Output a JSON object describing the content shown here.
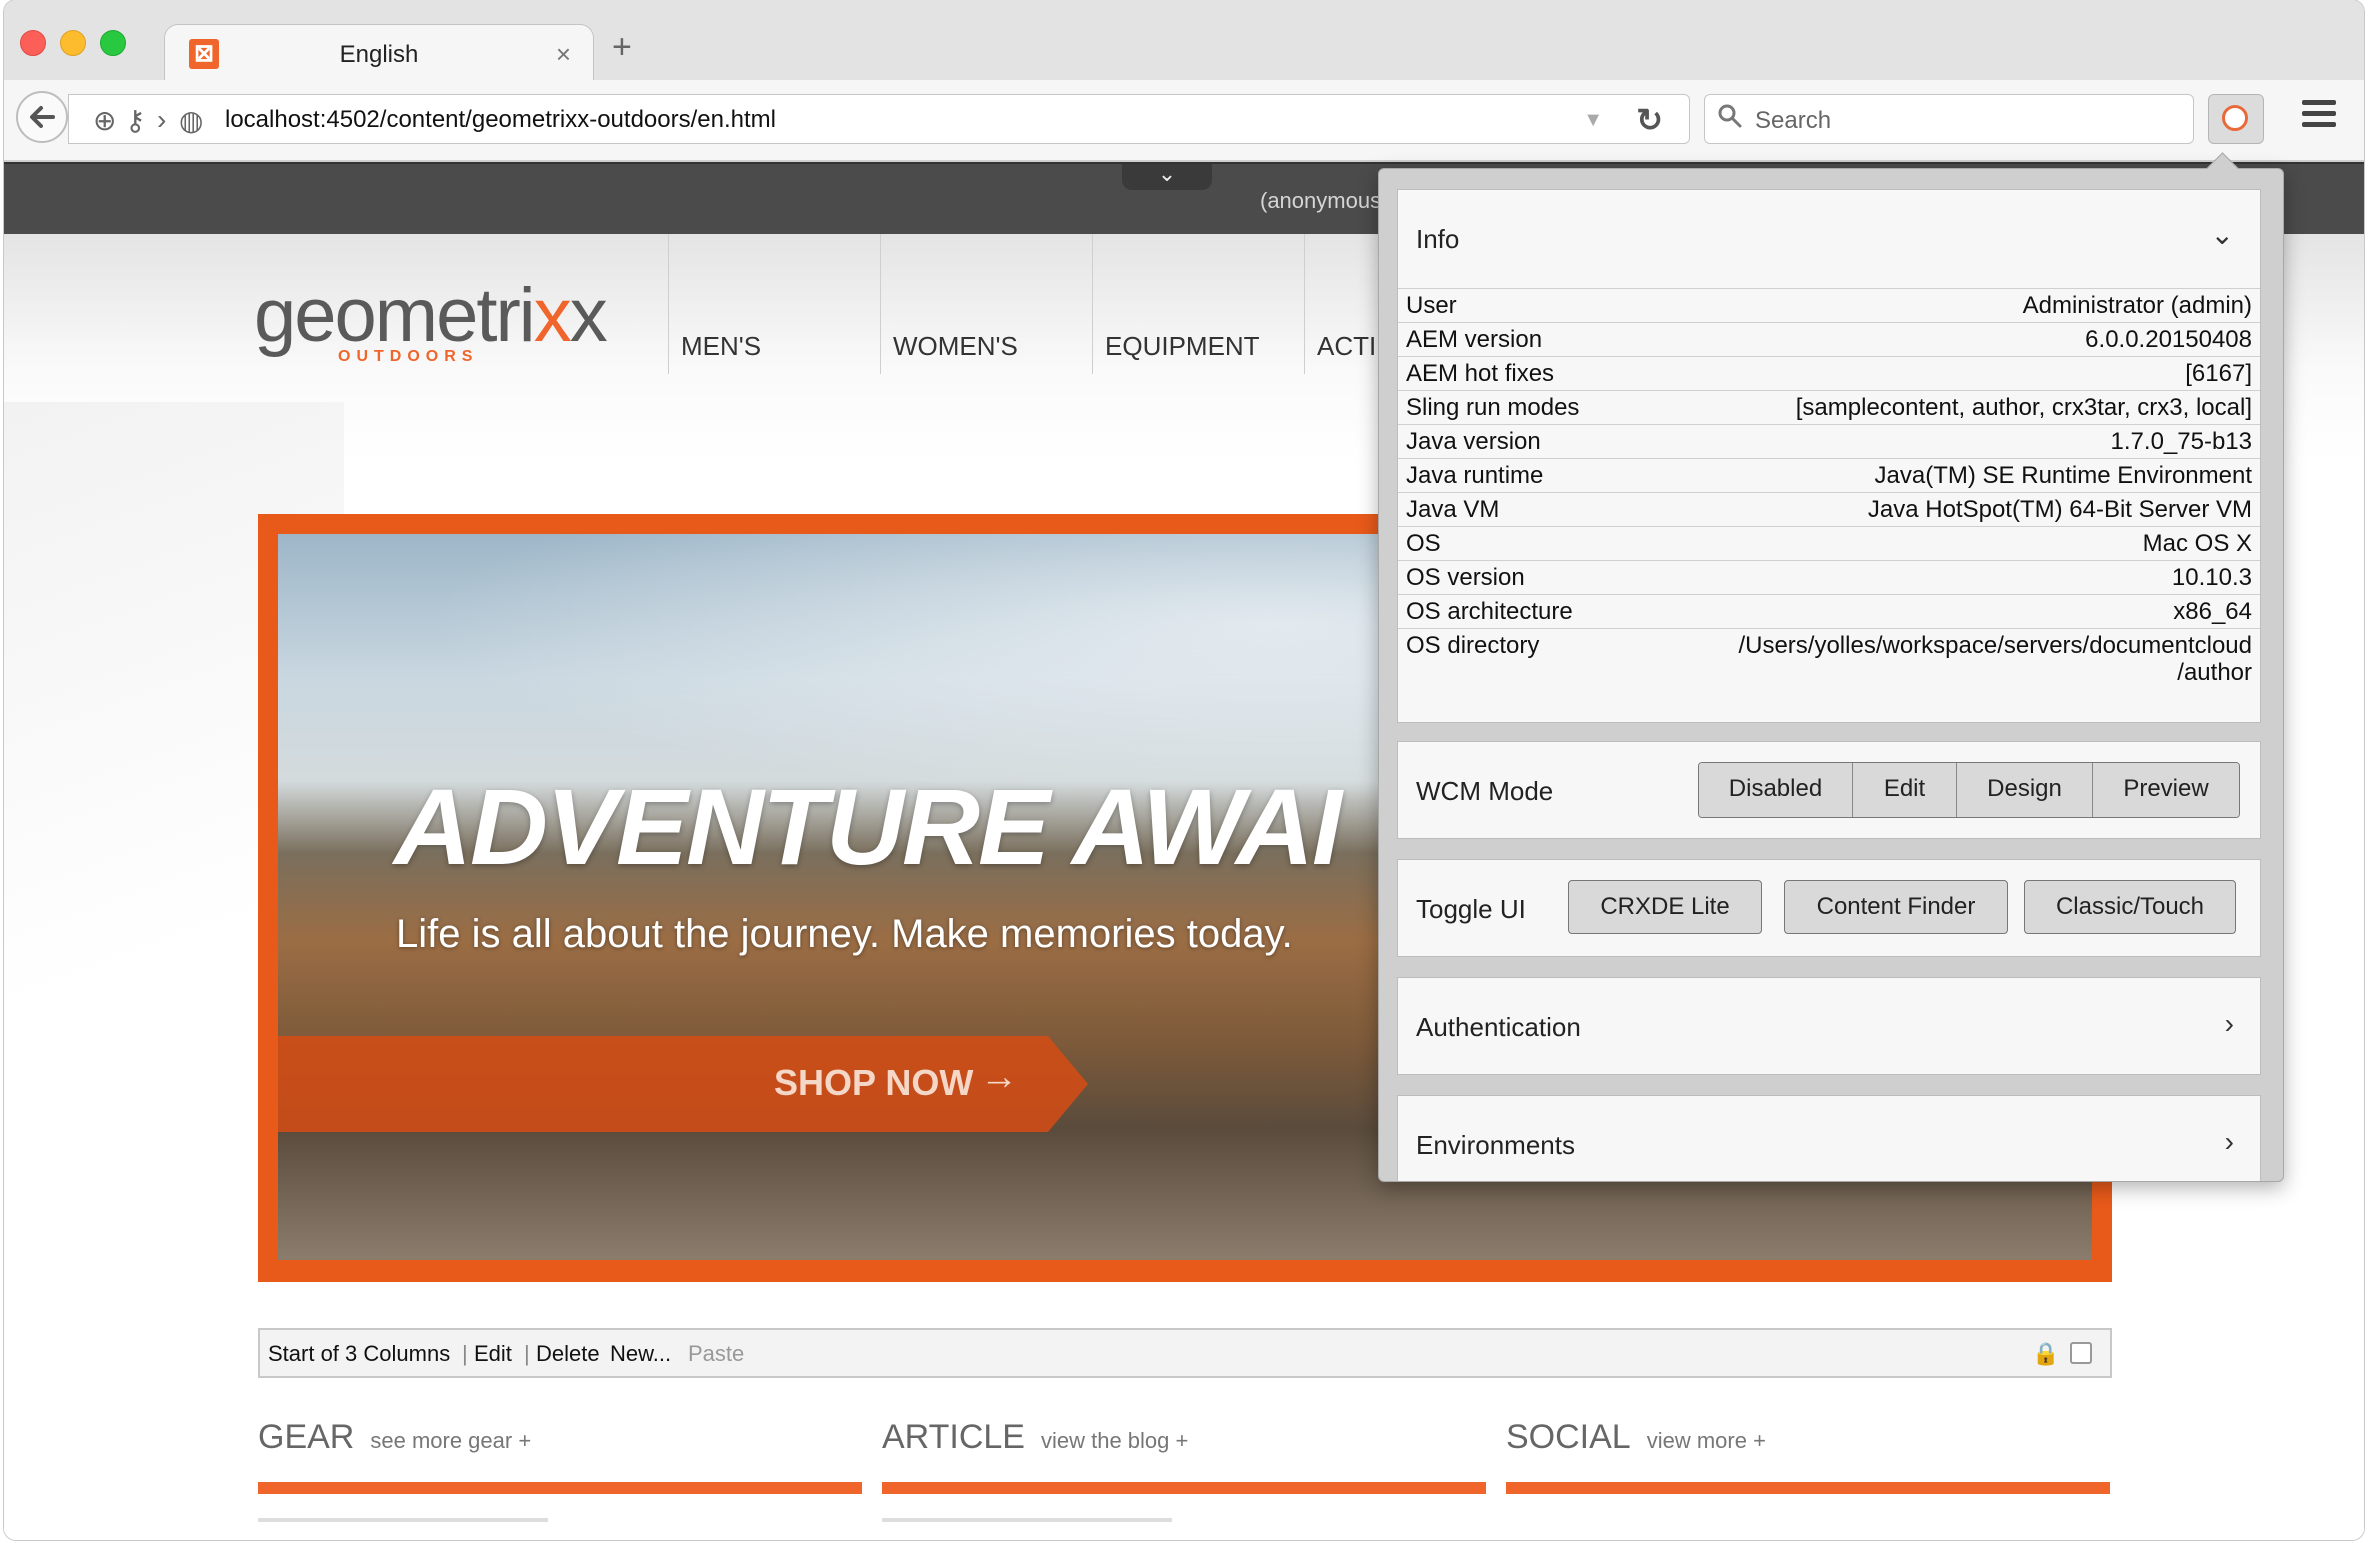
{
  "browser": {
    "tab_title": "English",
    "tab_close": "×",
    "new_tab": "+",
    "url": "localhost:4502/content/geometrixx-outdoors/en.html",
    "search_placeholder": "Search"
  },
  "aem_bar": {
    "toggle": "⌄",
    "user_label": "(anonymous"
  },
  "site": {
    "logo_text_a": "geometri",
    "logo_text_x": "x",
    "logo_text_b": "x",
    "logo_sub": "OUTDOORS",
    "nav": [
      "MEN'S",
      "WOMEN'S",
      "EQUIPMENT",
      "ACTI"
    ],
    "hero": {
      "title": "ADVENTURE AWAI",
      "subtitle": "Life is all about the journey. Make memories today.",
      "button": "SHOP NOW",
      "button_arrow": "→"
    },
    "editbar": {
      "label": "Start of 3 Columns",
      "edit": "Edit",
      "delete": "Delete",
      "new": "New...",
      "paste": "Paste"
    },
    "sections": [
      {
        "title": "GEAR",
        "link": "see more gear +"
      },
      {
        "title": "ARTICLE",
        "link": "view the blog +"
      },
      {
        "title": "SOCIAL",
        "link": "view more +"
      }
    ]
  },
  "panel": {
    "info": {
      "title": "Info",
      "chevron": "⌄",
      "rows": [
        {
          "label": "User",
          "value": "Administrator (admin)"
        },
        {
          "label": "AEM version",
          "value": "6.0.0.20150408"
        },
        {
          "label": "AEM hot fixes",
          "value": "[6167]"
        },
        {
          "label": "Sling run modes",
          "value": "[samplecontent, author, crx3tar, crx3, local]"
        },
        {
          "label": "Java version",
          "value": "1.7.0_75-b13"
        },
        {
          "label": "Java runtime",
          "value": "Java(TM) SE Runtime Environment"
        },
        {
          "label": "Java VM",
          "value": "Java HotSpot(TM) 64-Bit Server VM"
        },
        {
          "label": "OS",
          "value": "Mac OS X"
        },
        {
          "label": "OS version",
          "value": "10.10.3"
        },
        {
          "label": "OS architecture",
          "value": "x86_64"
        },
        {
          "label": "OS directory",
          "value": "/Users/yolles/workspace/servers/documentcloud\n/author"
        }
      ]
    },
    "wcm_mode": {
      "title": "WCM Mode",
      "options": [
        "Disabled",
        "Edit",
        "Design",
        "Preview"
      ]
    },
    "toggle_ui": {
      "title": "Toggle UI",
      "buttons": [
        "CRXDE Lite",
        "Content Finder",
        "Classic/Touch"
      ]
    },
    "authentication": {
      "title": "Authentication",
      "chevron": "›"
    },
    "environments": {
      "title": "Environments",
      "chevron": "›"
    }
  },
  "colors": {
    "brand_orange": "#f0652b",
    "aem_bar": "#4b4b4b",
    "panel_bg": "#cfcfcf"
  }
}
